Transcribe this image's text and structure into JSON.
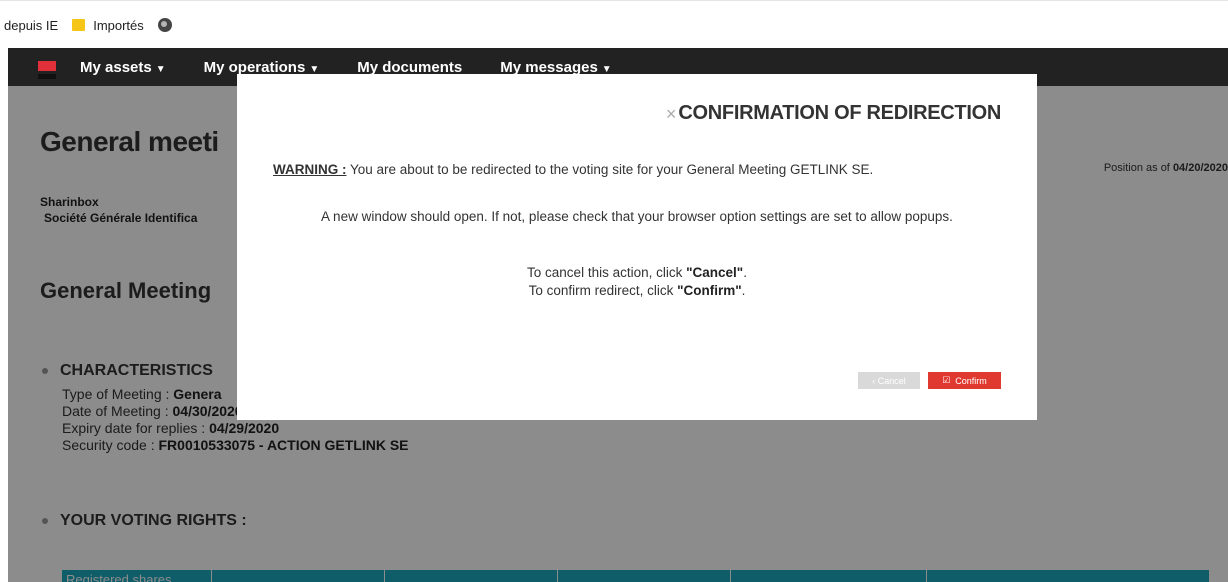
{
  "bookmarks": {
    "items": [
      {
        "label": "depuis IE"
      },
      {
        "label": "Importés"
      }
    ]
  },
  "nav": {
    "items": [
      {
        "label": "My assets",
        "dropdown": true
      },
      {
        "label": "My operations",
        "dropdown": true
      },
      {
        "label": "My documents",
        "dropdown": false
      },
      {
        "label": "My messages",
        "dropdown": true
      }
    ]
  },
  "page": {
    "title": "General meeti",
    "position_label": "Position as of",
    "position_date": "04/20/2020",
    "company_name": "Sharinbox",
    "company_sub": "Société Générale Identifica",
    "section_title": "General Meeting",
    "characteristics_title": "CHARACTERISTICS",
    "type_label": "Type of Meeting : ",
    "type_value": "Genera",
    "date_label": "Date of Meeting : ",
    "date_value": "04/30/2020",
    "expiry_label": "Expiry date for replies : ",
    "expiry_value": "04/29/2020",
    "security_label": "Security code : ",
    "security_value": "FR0010533075 - ACTION GETLINK SE",
    "voting_title": "YOUR VOTING RIGHTS :",
    "table_first_header": "Registered shares"
  },
  "modal": {
    "close_glyph": "×",
    "title": "CONFIRMATION OF REDIRECTION",
    "warning_label": "WARNING :",
    "warning_text": " You are about to be redirected to the voting site for your General Meeting GETLINK SE.",
    "line1": "A new window should open. If not, please check that your browser option settings are set to allow popups.",
    "cancel_prefix": "To cancel this action, click ",
    "cancel_word": "\"Cancel\"",
    "confirm_prefix": "To confirm redirect, click ",
    "confirm_word": "\"Confirm\"",
    "period": ".",
    "cancel_button": "‹  Cancel",
    "confirm_button": "Confirm",
    "confirm_icon_glyph": "☑"
  },
  "colors": {
    "accent_red": "#e03a30",
    "table_teal": "#1aa9bd",
    "navbar": "#222222"
  }
}
